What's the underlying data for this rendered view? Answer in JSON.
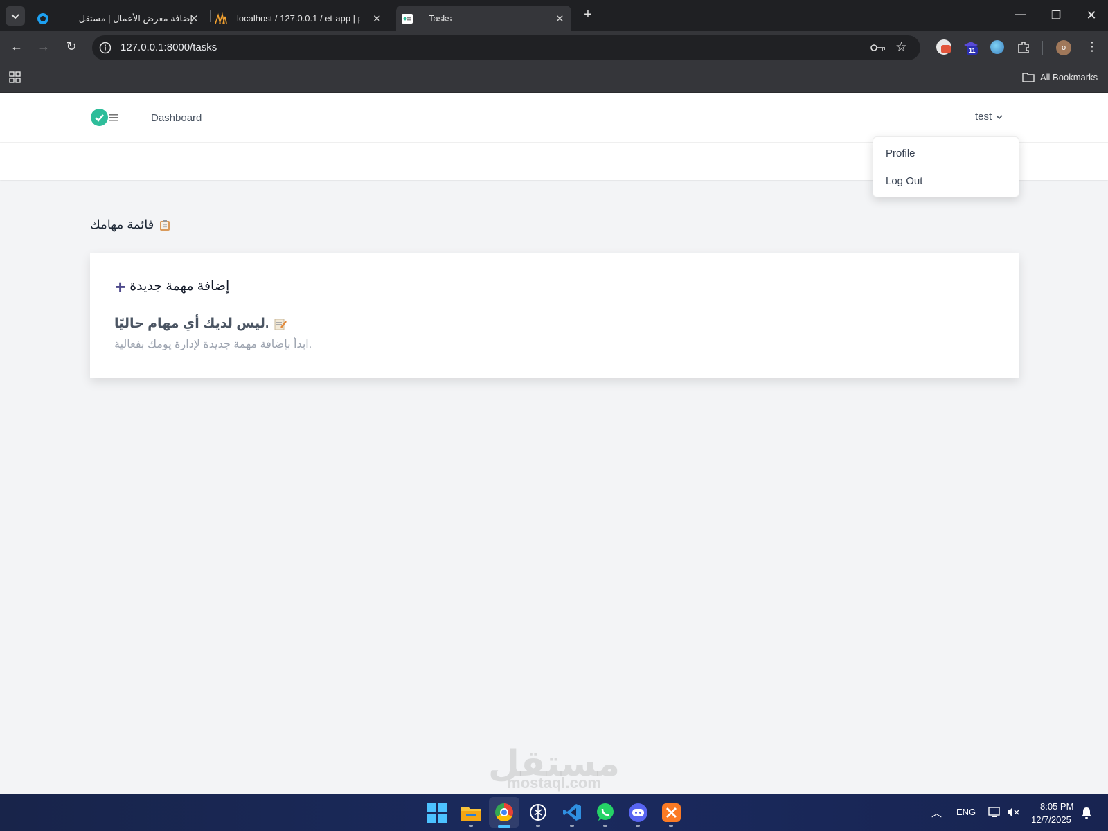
{
  "browser": {
    "tabs": [
      {
        "title": "إضافة معرض الأعمال | مستقل",
        "active": false
      },
      {
        "title": "localhost / 127.0.0.1 / et-app | p",
        "active": false
      },
      {
        "title": "Tasks",
        "active": true
      }
    ],
    "url": "127.0.0.1:8000/tasks",
    "bookmarks_label": "All Bookmarks",
    "profile_initial": "o",
    "extension_badge": "11"
  },
  "app": {
    "nav_dashboard": "Dashboard",
    "user_name": "test",
    "dropdown": {
      "profile": "Profile",
      "logout": "Log Out"
    },
    "list_title": "قائمة مهامك",
    "add_task": "إضافة مهمة جديدة",
    "empty_title": ".ليس لديك أي مهام حاليًا",
    "empty_subtitle": ".ابدأ بإضافة مهمة جديدة لإدارة يومك بفعالية",
    "accent_color": "#2ebd9a"
  },
  "watermark": {
    "arabic": "مستقل",
    "latin": "mostaql.com"
  },
  "taskbar": {
    "language": "ENG",
    "time": "8:05 PM",
    "date": "12/7/2025"
  }
}
